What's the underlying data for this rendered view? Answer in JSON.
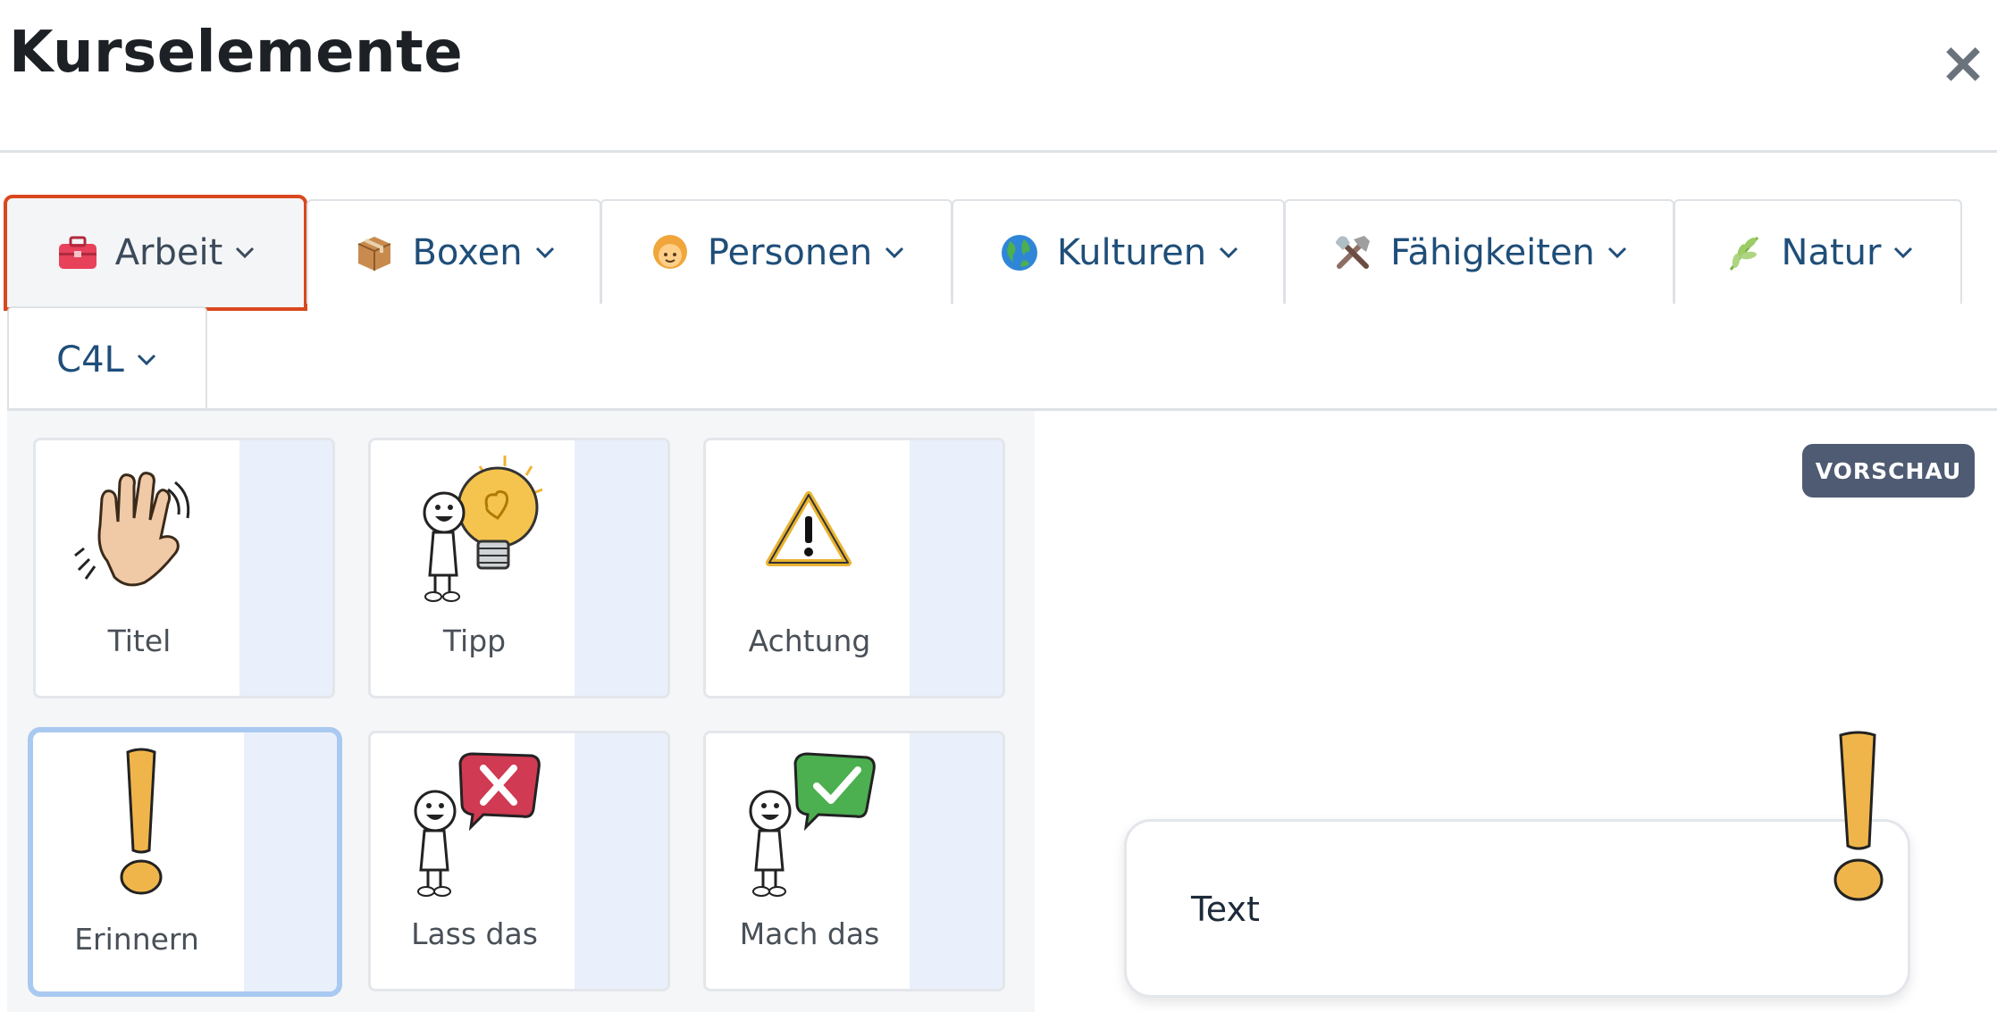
{
  "dialog": {
    "title": "Kurselemente",
    "close_symbol": "×"
  },
  "tabs": [
    {
      "label": "Arbeit",
      "icon": "toolbox-icon",
      "active": true
    },
    {
      "label": "Boxen",
      "icon": "package-icon",
      "active": false
    },
    {
      "label": "Personen",
      "icon": "person-icon",
      "active": false
    },
    {
      "label": "Kulturen",
      "icon": "globe-icon",
      "active": false
    },
    {
      "label": "Fähigkeiten",
      "icon": "tools-icon",
      "active": false
    },
    {
      "label": "Natur",
      "icon": "herb-icon",
      "active": false
    },
    {
      "label": "C4L",
      "icon": "",
      "active": false
    }
  ],
  "elements": [
    {
      "label": "Titel",
      "icon": "waving-hand-icon"
    },
    {
      "label": "Tipp",
      "icon": "lightbulb-figure-icon"
    },
    {
      "label": "Achtung",
      "icon": "warning-icon"
    },
    {
      "label": "Erinnern",
      "icon": "exclamation-icon",
      "selected": true
    },
    {
      "label": "Lass das",
      "icon": "dont-figure-icon"
    },
    {
      "label": "Mach das",
      "icon": "do-figure-icon"
    }
  ],
  "preview": {
    "badge": "VORSCHAU",
    "text": "Text"
  },
  "colors": {
    "accent_tab_border": "#d9481e",
    "tab_text": "#1f4e79",
    "badge_bg": "#4f5b72",
    "selected_border": "#a9c9f1"
  }
}
